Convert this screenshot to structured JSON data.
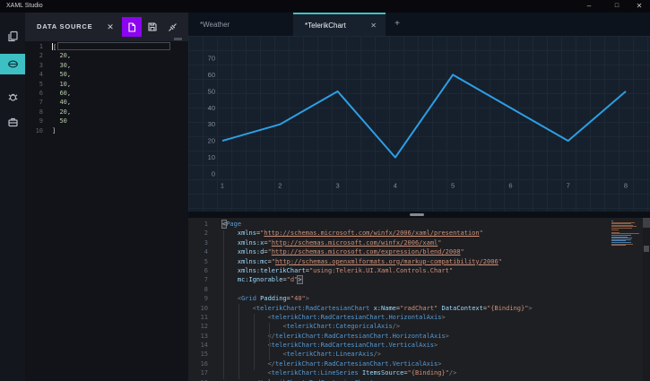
{
  "window": {
    "title": "XAML Studio"
  },
  "icons": {
    "minimize": "–",
    "maximize": "□",
    "close_window": "✕",
    "close": "✕",
    "add": "+",
    "activity": [
      "documents-icon",
      "data-source-icon",
      "debug-bug-icon",
      "toolbox-icon"
    ],
    "panel": [
      "close-icon",
      "new-file-icon",
      "save-icon",
      "disconnect-icon"
    ]
  },
  "colors": {
    "accent_teal": "#3ec1c5",
    "accent_purple": "#8b05f2",
    "chart_line": "#2d9ee4",
    "designer_bg": "#15202c",
    "editor_bg": "#1e1f23"
  },
  "activity_bar": {
    "items": [
      {
        "id": "documents",
        "selected": false
      },
      {
        "id": "data-source",
        "selected": true
      },
      {
        "id": "debug",
        "selected": false
      },
      {
        "id": "toolbox",
        "selected": false
      }
    ]
  },
  "data_source_panel": {
    "title": "DATA SOURCE",
    "decorations": {
      "cursor_line": 1,
      "match_box_line": 1
    },
    "editor_lines": [
      [
        [
          "b",
          "["
        ]
      ],
      [
        [
          "w",
          "  "
        ],
        [
          "n",
          "20"
        ],
        [
          "b",
          ","
        ]
      ],
      [
        [
          "w",
          "  "
        ],
        [
          "n",
          "30"
        ],
        [
          "b",
          ","
        ]
      ],
      [
        [
          "w",
          "  "
        ],
        [
          "n",
          "50"
        ],
        [
          "b",
          ","
        ]
      ],
      [
        [
          "w",
          "  "
        ],
        [
          "n",
          "10"
        ],
        [
          "b",
          ","
        ]
      ],
      [
        [
          "w",
          "  "
        ],
        [
          "n",
          "60"
        ],
        [
          "b",
          ","
        ]
      ],
      [
        [
          "w",
          "  "
        ],
        [
          "n",
          "40"
        ],
        [
          "b",
          ","
        ]
      ],
      [
        [
          "w",
          "  "
        ],
        [
          "n",
          "20"
        ],
        [
          "b",
          ","
        ]
      ],
      [
        [
          "w",
          "  "
        ],
        [
          "n",
          "50"
        ]
      ],
      [
        [
          "b",
          "]"
        ]
      ]
    ]
  },
  "tab_bar": {
    "tabs": [
      {
        "label": "*Weather",
        "active": false
      },
      {
        "label": "*TelerikChart",
        "active": true,
        "closable": true
      }
    ],
    "new_tab": "+"
  },
  "chart_data": {
    "type": "line",
    "x": [
      1,
      2,
      3,
      4,
      5,
      6,
      7,
      8
    ],
    "values": [
      20,
      30,
      50,
      10,
      60,
      40,
      20,
      50
    ],
    "title": "",
    "xlabel": "",
    "ylabel": "",
    "ylim": [
      0,
      70
    ],
    "ytick_step": 10,
    "grid": true,
    "legend": "none",
    "line_color": "#2d9ee4",
    "tick_color": "#828c98"
  },
  "code_editor": {
    "lines": [
      [
        [
          "pb",
          "<"
        ],
        [
          "t",
          "Page"
        ]
      ],
      [
        [
          "w",
          "    "
        ],
        [
          "a",
          "xmlns"
        ],
        [
          "o",
          "="
        ],
        [
          "s",
          "\""
        ],
        [
          "u",
          "http://schemas.microsoft.com/winfx/2006/xaml/presentation"
        ],
        [
          "s",
          "\""
        ]
      ],
      [
        [
          "w",
          "    "
        ],
        [
          "a",
          "xmlns:x"
        ],
        [
          "o",
          "="
        ],
        [
          "s",
          "\""
        ],
        [
          "u",
          "http://schemas.microsoft.com/winfx/2006/xaml"
        ],
        [
          "s",
          "\""
        ]
      ],
      [
        [
          "w",
          "    "
        ],
        [
          "a",
          "xmlns:d"
        ],
        [
          "o",
          "="
        ],
        [
          "s",
          "\""
        ],
        [
          "u",
          "http://schemas.microsoft.com/expression/blend/2008"
        ],
        [
          "s",
          "\""
        ]
      ],
      [
        [
          "w",
          "    "
        ],
        [
          "a",
          "xmlns:mc"
        ],
        [
          "o",
          "="
        ],
        [
          "s",
          "\""
        ],
        [
          "u",
          "http://schemas.openxmlformats.org/markup-compatibility/2006"
        ],
        [
          "s",
          "\""
        ]
      ],
      [
        [
          "w",
          "    "
        ],
        [
          "a",
          "xmlns:telerikChart"
        ],
        [
          "o",
          "="
        ],
        [
          "s",
          "\"using:Telerik.UI.Xaml.Controls.Chart\""
        ]
      ],
      [
        [
          "w",
          "    "
        ],
        [
          "a",
          "mc:Ignorable"
        ],
        [
          "o",
          "="
        ],
        [
          "s",
          "\"d\""
        ],
        [
          "pb",
          ">"
        ]
      ],
      [],
      [
        [
          "w",
          "    "
        ],
        [
          "p",
          "<"
        ],
        [
          "t",
          "Grid"
        ],
        [
          "w",
          " "
        ],
        [
          "a",
          "Padding"
        ],
        [
          "o",
          "="
        ],
        [
          "s",
          "\"40\""
        ],
        [
          "p",
          ">"
        ]
      ],
      [
        [
          "w",
          "        "
        ],
        [
          "p",
          "<"
        ],
        [
          "t",
          "telerikChart:RadCartesianChart"
        ],
        [
          "w",
          " "
        ],
        [
          "a",
          "x:Name"
        ],
        [
          "o",
          "="
        ],
        [
          "s",
          "\"radChart\""
        ],
        [
          "w",
          " "
        ],
        [
          "a",
          "DataContext"
        ],
        [
          "o",
          "="
        ],
        [
          "s",
          "\"{Binding}\""
        ],
        [
          "p",
          ">"
        ]
      ],
      [
        [
          "w",
          "            "
        ],
        [
          "p",
          "<"
        ],
        [
          "t",
          "telerikChart:RadCartesianChart.HorizontalAxis"
        ],
        [
          "p",
          ">"
        ]
      ],
      [
        [
          "w",
          "                "
        ],
        [
          "p",
          "<"
        ],
        [
          "t",
          "telerikChart:CategoricalAxis"
        ],
        [
          "p",
          "/>"
        ]
      ],
      [
        [
          "w",
          "            "
        ],
        [
          "p",
          "</"
        ],
        [
          "t",
          "telerikChart:RadCartesianChart.HorizontalAxis"
        ],
        [
          "p",
          ">"
        ]
      ],
      [
        [
          "w",
          "            "
        ],
        [
          "p",
          "<"
        ],
        [
          "t",
          "telerikChart:RadCartesianChart.VerticalAxis"
        ],
        [
          "p",
          ">"
        ]
      ],
      [
        [
          "w",
          "                "
        ],
        [
          "p",
          "<"
        ],
        [
          "t",
          "telerikChart:LinearAxis"
        ],
        [
          "p",
          "/>"
        ]
      ],
      [
        [
          "w",
          "            "
        ],
        [
          "p",
          "</"
        ],
        [
          "t",
          "telerikChart:RadCartesianChart.VerticalAxis"
        ],
        [
          "p",
          ">"
        ]
      ],
      [
        [
          "w",
          "            "
        ],
        [
          "p",
          "<"
        ],
        [
          "t",
          "telerikChart:LineSeries"
        ],
        [
          "w",
          " "
        ],
        [
          "a",
          "ItemsSource"
        ],
        [
          "o",
          "="
        ],
        [
          "s",
          "\"{Binding}\""
        ],
        [
          "p",
          "/>"
        ]
      ],
      [
        [
          "w",
          "        "
        ],
        [
          "p",
          "</"
        ],
        [
          "t",
          "telerikChart:RadCartesianChart"
        ],
        [
          "p",
          ">"
        ]
      ]
    ]
  }
}
